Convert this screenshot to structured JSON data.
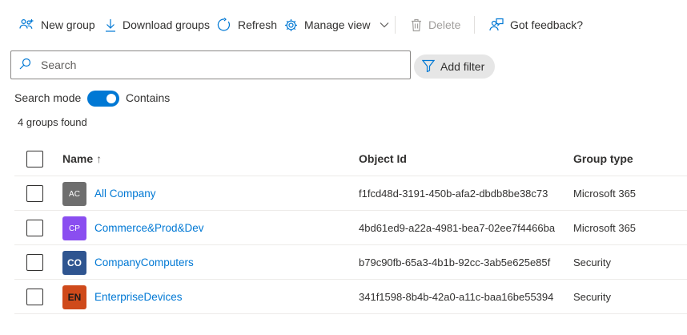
{
  "toolbar": {
    "new_group": "New group",
    "download_groups": "Download groups",
    "refresh": "Refresh",
    "manage_view": "Manage view",
    "delete": "Delete",
    "feedback": "Got feedback?"
  },
  "search": {
    "placeholder": "Search",
    "value": ""
  },
  "filter": {
    "label": "Add filter"
  },
  "search_mode": {
    "label": "Search mode",
    "value": "Contains",
    "enabled": true
  },
  "result_count": "4 groups found",
  "table": {
    "columns": {
      "name": "Name",
      "sort_indicator": "↑",
      "object_id": "Object Id",
      "group_type": "Group type"
    },
    "rows": [
      {
        "initials": "AC",
        "name": "All Company",
        "object_id": "f1fcd48d-3191-450b-afa2-dbdb8be38c73",
        "group_type": "Microsoft 365",
        "avatar_color": "#6e6e6e"
      },
      {
        "initials": "CP",
        "name": "Commerce&Prod&Dev",
        "object_id": "4bd61ed9-a22a-4981-bea7-02ee7f4466ba",
        "group_type": "Microsoft 365",
        "avatar_color": "#8a4ef0"
      },
      {
        "initials": "CO",
        "name": "CompanyComputers",
        "object_id": "b79c90fb-65a3-4b1b-92cc-3ab5e625e85f",
        "group_type": "Security",
        "avatar_color": "#2f5590"
      },
      {
        "initials": "EN",
        "name": "EnterpriseDevices",
        "object_id": "341f1598-8b4b-42a0-a11c-baa16be55394",
        "group_type": "Security",
        "avatar_color": "#cf4a1b"
      }
    ]
  },
  "colors": {
    "accent": "#0078d4",
    "link": "#0078d4",
    "disabled": "#a19f9d"
  },
  "icons": [
    "group-add-icon",
    "download-icon",
    "refresh-icon",
    "gear-icon",
    "chevron-down-icon",
    "trash-icon",
    "feedback-icon",
    "search-icon",
    "filter-icon"
  ]
}
